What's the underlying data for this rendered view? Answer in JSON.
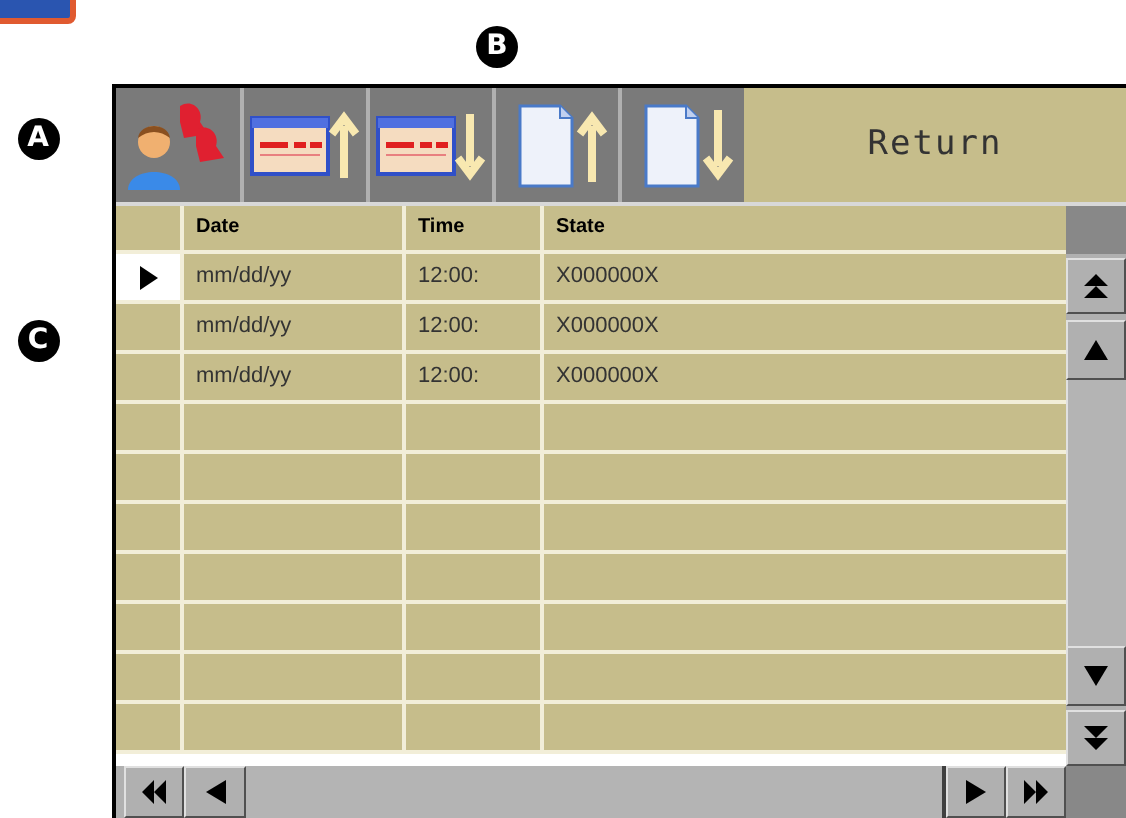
{
  "callouts": [
    "A",
    "B",
    "C"
  ],
  "toolbar": {
    "return_label": "Return"
  },
  "table": {
    "columns": [
      "Date",
      "Time",
      "State"
    ],
    "rows": [
      {
        "date": "mm/dd/yy",
        "time": "12:00:",
        "state": "X000000X",
        "selected": true
      },
      {
        "date": "mm/dd/yy",
        "time": "12:00:",
        "state": "X000000X",
        "selected": false
      },
      {
        "date": "mm/dd/yy",
        "time": "12:00:",
        "state": "X000000X",
        "selected": false
      }
    ]
  }
}
